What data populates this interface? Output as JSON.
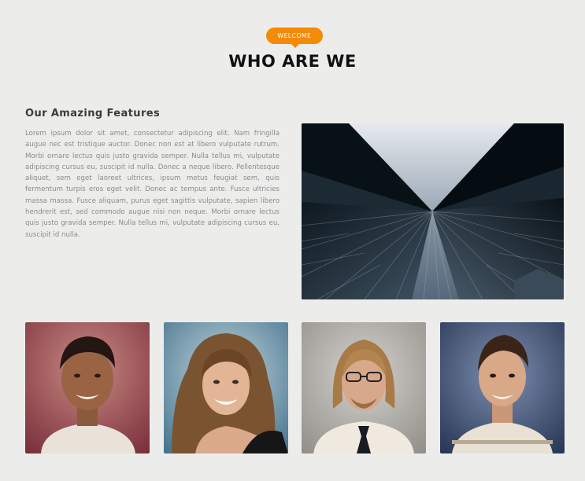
{
  "section": {
    "badge": "WELCOME",
    "title": "WHO ARE WE"
  },
  "features": {
    "heading": "Our Amazing Features",
    "body": "Lorem ipsum dolor sit amet, consectetur adipiscing elit. Nam fringilla augue nec est tristique auctor. Donec non est at libero vulputate rutrum. Morbi ornare lectus quis justo gravida semper. Nulla tellus mi, vulputate adipiscing cursus eu, suscipit id nulla. Donec a neque libero. Pellentesque aliquet, sem eget laoreet ultrices, ipsum metus feugiat sem, quis fermentum turpis eros eget velit. Donec ac tempus ante. Fusce ultricies massa massa. Fusce aliquam, purus eget sagittis vulputate, sapien libero hendrerit est, sed commodo augue nisi non neque. Morbi ornare lectus quis justo gravida semper. Nulla tellus mi, vulputate adipiscing cursus eu, suscipit id nulla."
  },
  "colors": {
    "accent": "#f58a07",
    "background": "#ecedeb",
    "title": "#111111",
    "body_text": "#8b8b8b"
  },
  "images": {
    "feature_image": "skyscraper-photo",
    "team": [
      "team-member-1",
      "team-member-2",
      "team-member-3",
      "team-member-4"
    ]
  }
}
